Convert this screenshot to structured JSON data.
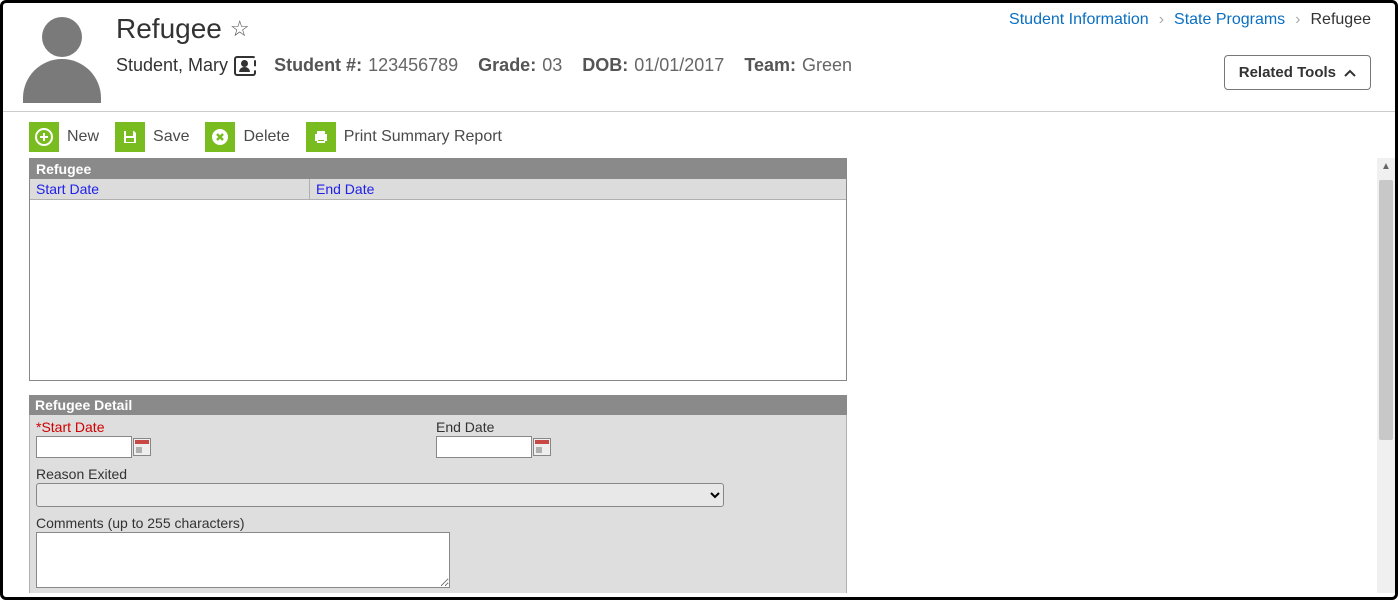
{
  "page_title": "Refugee",
  "student": {
    "name": "Student, Mary",
    "number_label": "Student #:",
    "number": "123456789",
    "grade_label": "Grade:",
    "grade": "03",
    "dob_label": "DOB:",
    "dob": "01/01/2017",
    "team_label": "Team:",
    "team": "Green"
  },
  "breadcrumb": {
    "a": "Student Information",
    "b": "State Programs",
    "c": "Refugee"
  },
  "related_tools_label": "Related Tools",
  "toolbar": {
    "new": "New",
    "save": "Save",
    "delete": "Delete",
    "print": "Print Summary Report"
  },
  "list": {
    "title": "Refugee",
    "cols": {
      "start": "Start Date",
      "end": "End Date"
    },
    "rows": []
  },
  "detail": {
    "title": "Refugee Detail",
    "start_label": "*Start Date",
    "start_value": "",
    "end_label": "End Date",
    "end_value": "",
    "reason_label": "Reason Exited",
    "reason_value": "",
    "comments_label": "Comments (up to 255 characters)",
    "comments_value": ""
  }
}
